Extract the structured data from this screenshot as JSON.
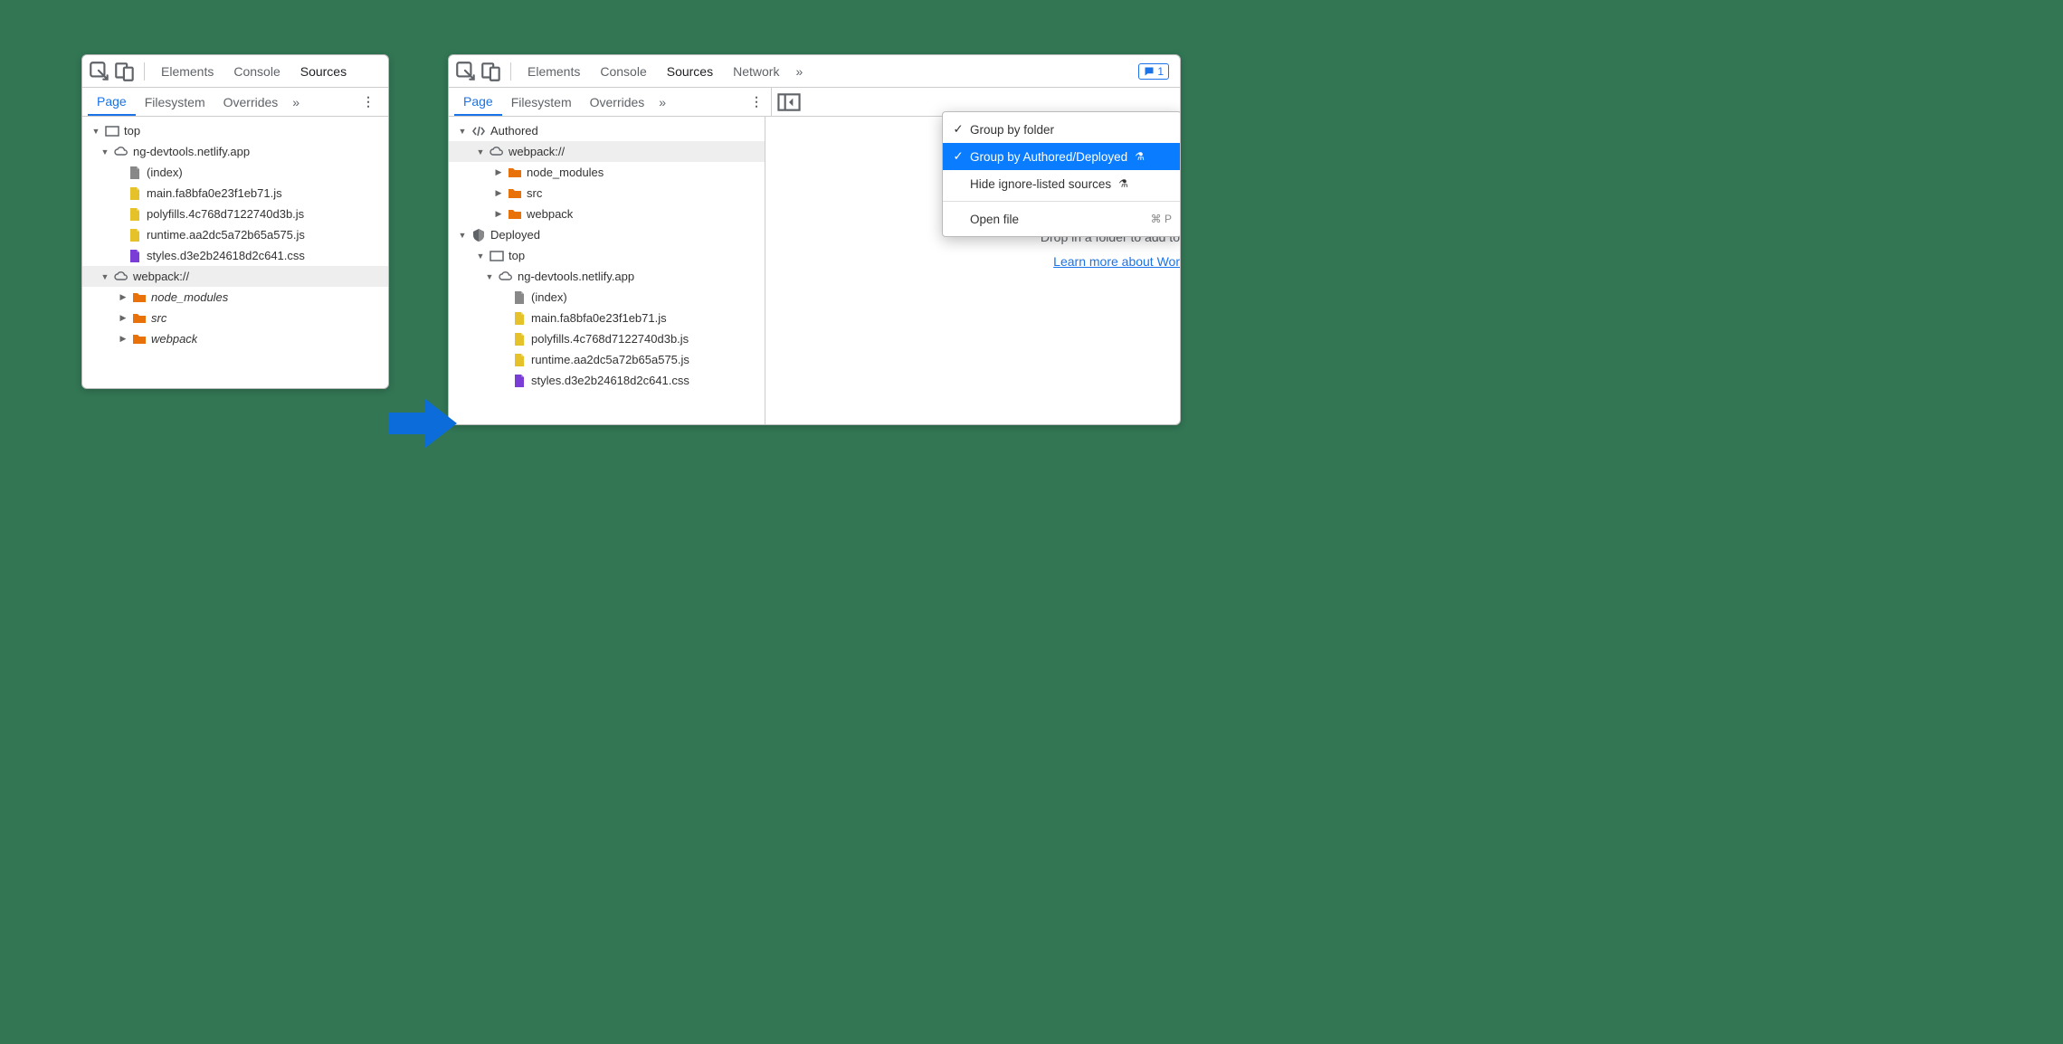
{
  "top_tabs": {
    "elements": "Elements",
    "console": "Console",
    "sources": "Sources",
    "network": "Network"
  },
  "sub_tabs": {
    "page": "Page",
    "filesystem": "Filesystem",
    "overrides": "Overrides"
  },
  "issues_badge": "1",
  "left_tree": {
    "top": "top",
    "domain": "ng-devtools.netlify.app",
    "index": "(index)",
    "main_js": "main.fa8bfa0e23f1eb71.js",
    "polyfills_js": "polyfills.4c768d7122740d3b.js",
    "runtime_js": "runtime.aa2dc5a72b65a575.js",
    "styles_css": "styles.d3e2b24618d2c641.css",
    "webpack": "webpack://",
    "node_modules": "node_modules",
    "src": "src",
    "webpack_folder": "webpack"
  },
  "right_tree": {
    "authored": "Authored",
    "webpack": "webpack://",
    "node_modules": "node_modules",
    "src": "src",
    "webpack_folder": "webpack",
    "deployed": "Deployed",
    "top": "top",
    "domain": "ng-devtools.netlify.app",
    "index": "(index)",
    "main_js": "main.fa8bfa0e23f1eb71.js",
    "polyfills_js": "polyfills.4c768d7122740d3b.js",
    "runtime_js": "runtime.aa2dc5a72b65a575.js",
    "styles_css": "styles.d3e2b24618d2c641.css"
  },
  "menu": {
    "group_folder": "Group by folder",
    "group_authored": "Group by Authored/Deployed",
    "hide_ignore": "Hide ignore-listed sources",
    "open_file": "Open file",
    "open_shortcut": "⌘ P"
  },
  "drop_text": "Drop in a folder to add to",
  "learn_link": "Learn more about Wor"
}
